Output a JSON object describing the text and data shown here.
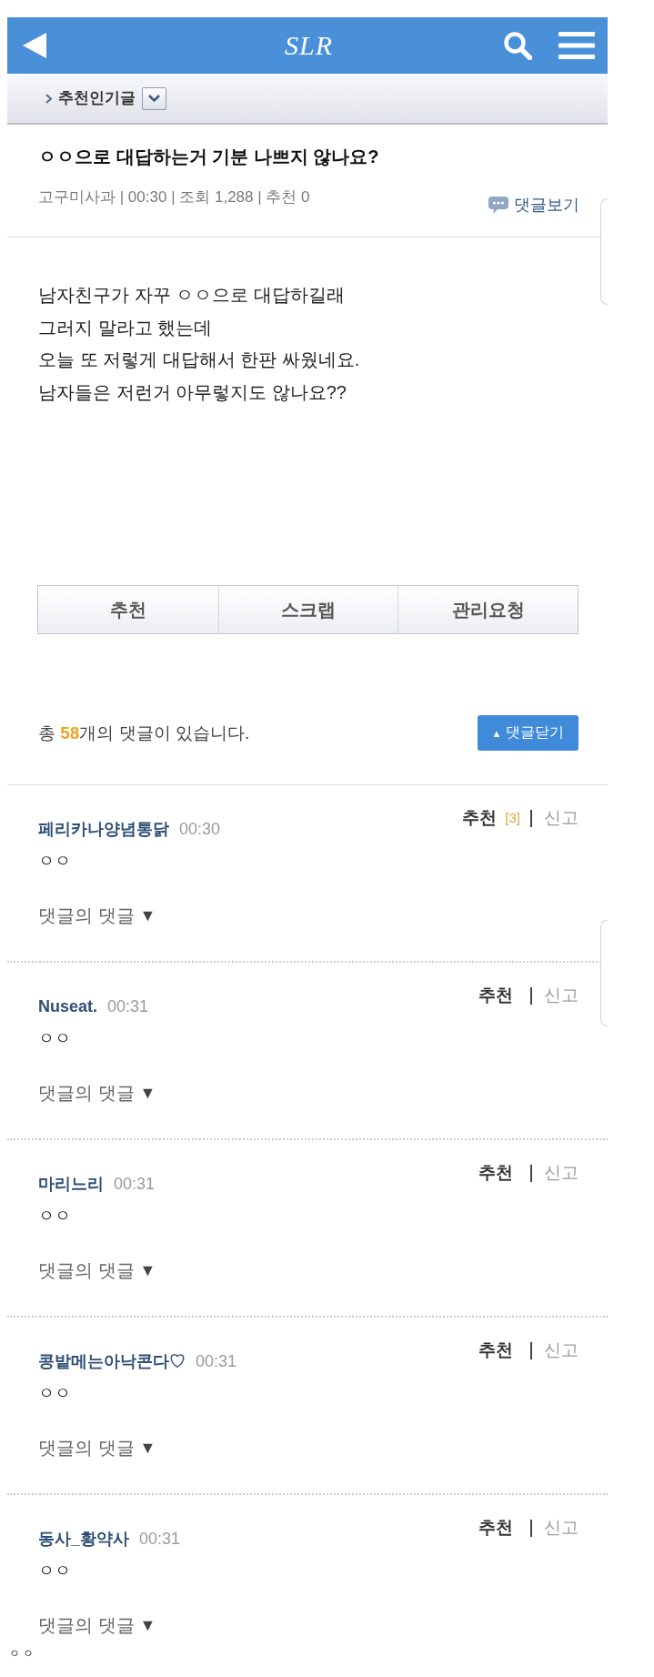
{
  "header": {
    "logo": "SLR"
  },
  "breadcrumb": {
    "label": "추천인기글"
  },
  "post": {
    "title": "ㅇㅇ으로 대답하는거 기분 나쁘지 않나요?",
    "meta": "고구미사과 | 00:30 | 조회 1,288 | 추천 0",
    "view_comments": "댓글보기",
    "body": "남자친구가 자꾸 ㅇㅇ으로 대답하길래\n그러지 말라고 했는데\n오늘 또 저렇게 대답해서 한판 싸웠네요.\n남자들은 저런거 아무렇지도 않나요??"
  },
  "actions": [
    "추천",
    "스크랩",
    "관리요청"
  ],
  "comments_header": {
    "summary": "총 **58**개의 댓글이 있습니다.",
    "toggle_icon": "▲",
    "toggle_label": "댓글닫기"
  },
  "comments": [
    {
      "author": "페리카나양념통닭",
      "time": "00:30",
      "text": "ㅇㅇ",
      "recommend": "추천",
      "recommend_count": "[3]",
      "report": "신고",
      "reply_label": "댓글의 댓글",
      "reply_arrow": "▼"
    },
    {
      "author": "Nuseat.",
      "time": "00:31",
      "text": "ㅇㅇ",
      "recommend": "추천",
      "report": "신고",
      "reply_label": "댓글의 댓글",
      "reply_arrow": "▼"
    },
    {
      "author": "마리느리",
      "time": "00:31",
      "text": "ㅇㅇ",
      "recommend": "추천",
      "report": "신고",
      "reply_label": "댓글의 댓글",
      "reply_arrow": "▼"
    },
    {
      "author": "콩밭메는아낙콘다♡",
      "time": "00:31",
      "text": "ㅇㅇ",
      "recommend": "추천",
      "report": "신고",
      "reply_label": "댓글의 댓글",
      "reply_arrow": "▼"
    },
    {
      "author": "동사_황약사",
      "time": "00:31",
      "text": "ㅇㅇ",
      "recommend": "추천",
      "report": "신고",
      "reply_label": "댓글의 댓글",
      "reply_arrow": "▼"
    }
  ],
  "caption": "ㅇ ㅇ"
}
